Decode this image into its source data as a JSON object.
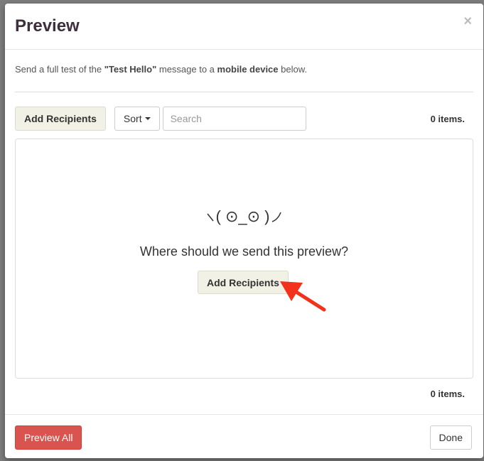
{
  "modal": {
    "title": "Preview",
    "close": "×"
  },
  "intro": {
    "pre": "Send a full test of the ",
    "message": "\"Test Hello\"",
    "mid": " message to a ",
    "device": "mobile device",
    "post": " below."
  },
  "toolbar": {
    "add_label": "Add Recipients",
    "sort_label": "Sort",
    "search_placeholder": "Search",
    "count": "0 items."
  },
  "empty": {
    "kaomoji": "( ⊙_⊙ )",
    "question": "Where should we send this preview?",
    "add_label": "Add Recipients"
  },
  "footer_count": "0 items.",
  "footer": {
    "preview_all": "Preview All",
    "done": "Done"
  },
  "colors": {
    "primary_danger": "#d9534f",
    "cream_button": "#f2f1e5",
    "annotation_arrow": "#f3321b"
  }
}
